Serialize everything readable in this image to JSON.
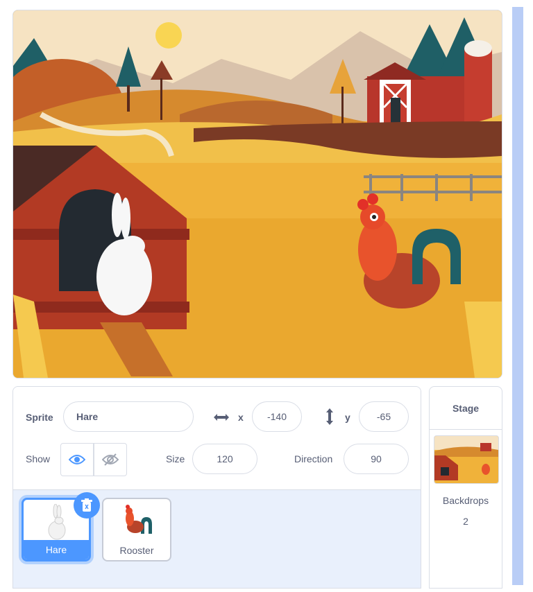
{
  "sprite_info": {
    "sprite_label": "Sprite",
    "sprite_name": "Hare",
    "x_label": "x",
    "x_value": "-140",
    "y_label": "y",
    "y_value": "-65",
    "show_label": "Show",
    "size_label": "Size",
    "size_value": "120",
    "direction_label": "Direction",
    "direction_value": "90"
  },
  "sprites": [
    {
      "name": "Hare",
      "selected": true
    },
    {
      "name": "Rooster",
      "selected": false
    }
  ],
  "stage_panel": {
    "title": "Stage",
    "backdrops_label": "Backdrops",
    "backdrops_count": "2"
  },
  "colors": {
    "accent": "#4c97ff",
    "selected_sprite": "#855cd6",
    "border": "#d9dde6",
    "text": "#575e75",
    "sprite_list_bg": "#e9f0fc"
  }
}
